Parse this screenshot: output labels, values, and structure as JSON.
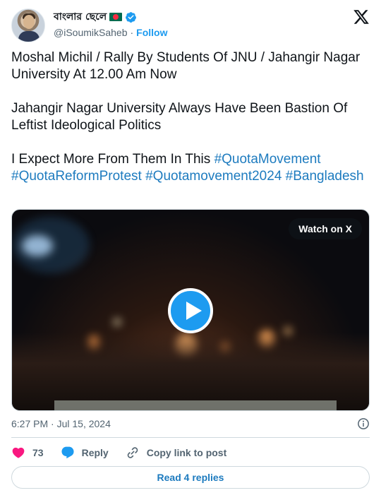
{
  "author": {
    "display_name": "বাংলার ছেলে",
    "handle": "@iSoumikSaheb",
    "separator": "·",
    "follow_label": "Follow",
    "verified": true,
    "flag_icon": "bangladesh-flag-icon"
  },
  "tweet": {
    "line1": "Moshal Michil / Rally By Students Of JNU / Jahangir Nagar University At 12.00 Am Now",
    "line2": "Jahangir Nagar University Always Have Been Bastion Of Leftist Ideological Politics",
    "line3_prefix": "I Expect More From Them In This ",
    "hashtags": [
      "#QuotaMovement",
      "#QuotaReformProtest",
      "#Quotamovement2024",
      "#Bangladesh"
    ]
  },
  "media": {
    "watch_label": "Watch on X",
    "play_icon": "play-icon"
  },
  "timestamp": "6:27 PM · Jul 15, 2024",
  "actions": {
    "like_count": "73",
    "reply_label": "Reply",
    "copy_label": "Copy link to post"
  },
  "read_replies_label": "Read 4 replies",
  "colors": {
    "accent": "#1d9bf0",
    "link": "#1d7bbf",
    "like": "#f91880",
    "muted": "#536471"
  }
}
